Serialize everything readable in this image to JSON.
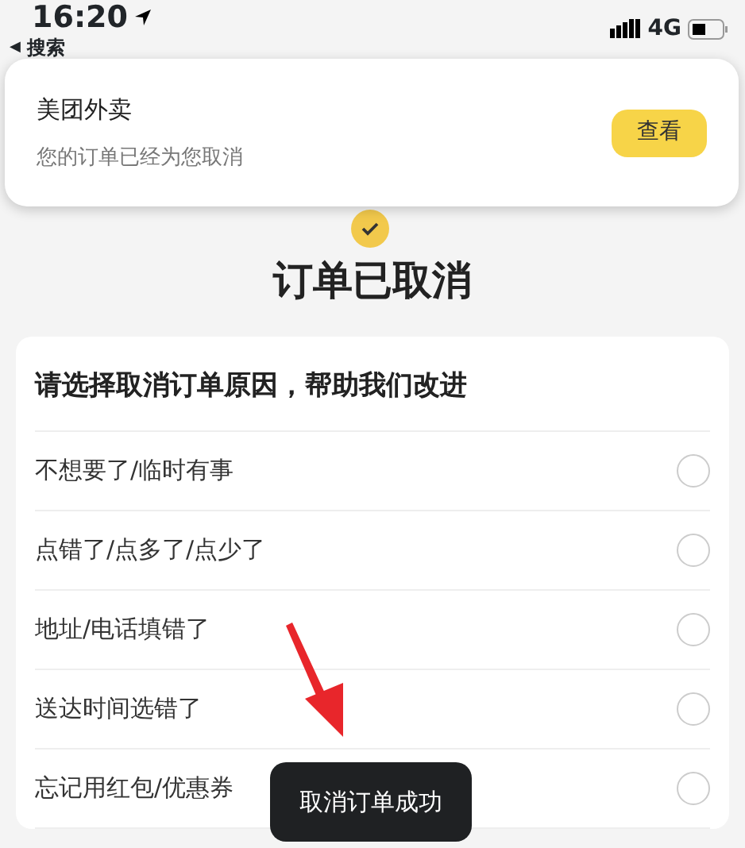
{
  "status_bar": {
    "time": "16:20",
    "network": "4G"
  },
  "back_link": {
    "arrow": "◀",
    "label": "搜索"
  },
  "notification": {
    "app": "美团外卖",
    "message": "您的订单已经为您取消",
    "button": "查看"
  },
  "title": "订单已取消",
  "reasons": {
    "heading": "请选择取消订单原因，帮助我们改进",
    "options": [
      {
        "label": "不想要了/临时有事",
        "selected": false
      },
      {
        "label": "点错了/点多了/点少了",
        "selected": false
      },
      {
        "label": "地址/电话填错了",
        "selected": false
      },
      {
        "label": "送达时间选错了",
        "selected": false
      },
      {
        "label": "忘记用红包/优惠券",
        "selected": false
      }
    ]
  },
  "toast": "取消订单成功"
}
